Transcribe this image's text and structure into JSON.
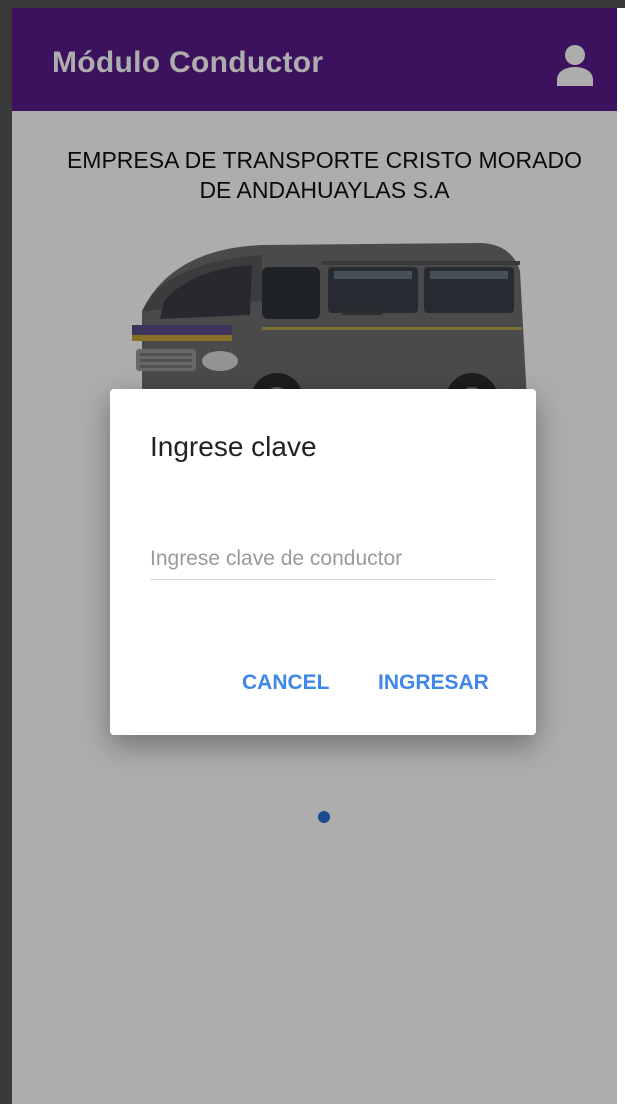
{
  "appbar": {
    "title": "Módulo Conductor",
    "icon": "account-icon",
    "color": "#591a8a"
  },
  "company": {
    "line1": "EMPRESA DE TRANSPORTE CRISTO MORADO",
    "line2": "DE ANDAHUAYLAS S.A"
  },
  "dialog": {
    "title": "Ingrese clave",
    "input": {
      "placeholder": "Ingrese clave de conductor",
      "value": ""
    },
    "cancel_label": "CANCEL",
    "confirm_label": "INGRESAR",
    "button_color": "#3f87e8"
  },
  "loading": {
    "indicator_color": "#2a6fd6"
  }
}
